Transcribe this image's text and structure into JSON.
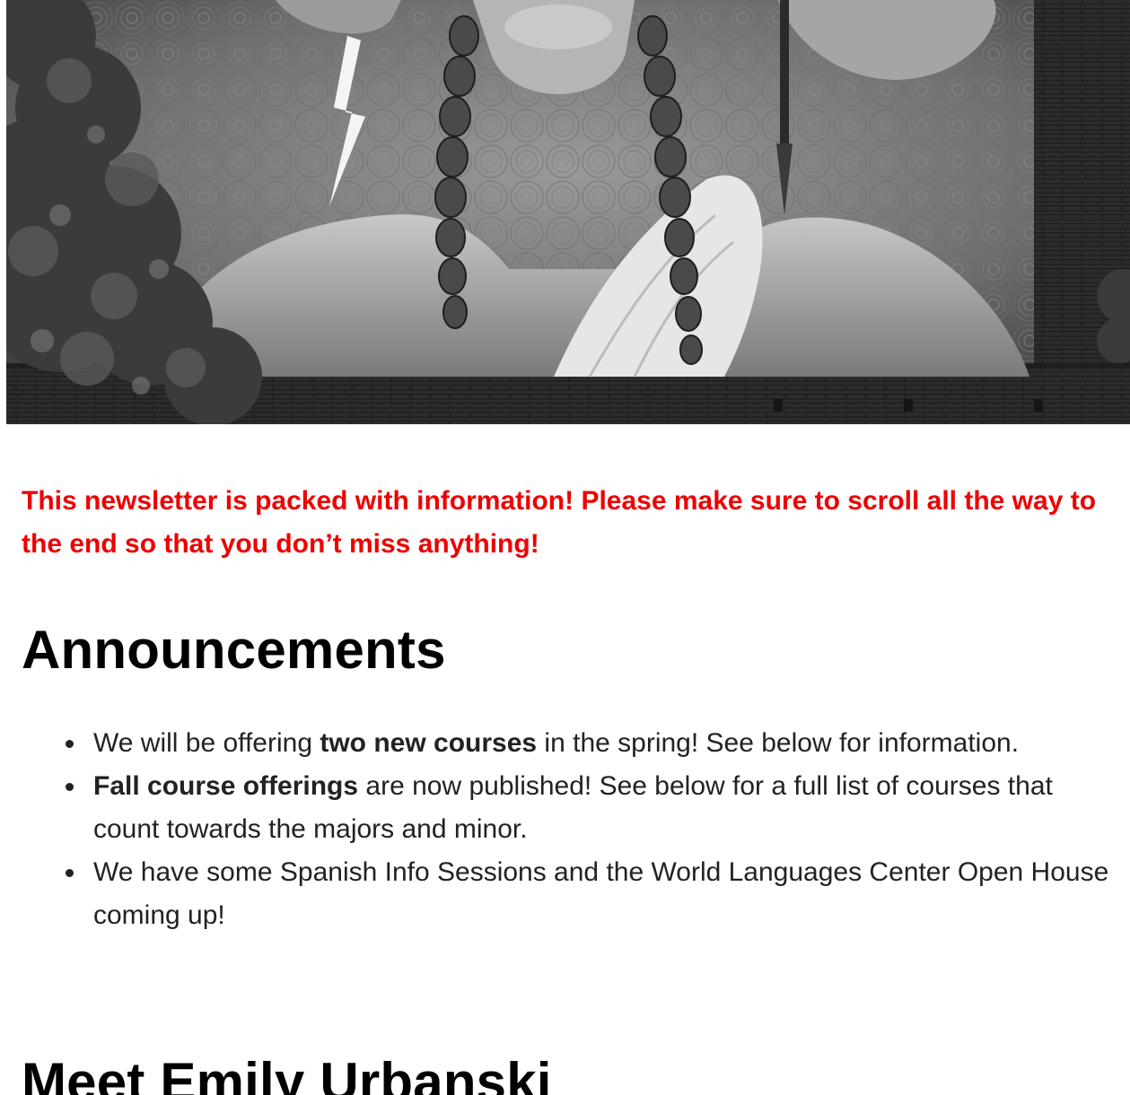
{
  "hero": {
    "image_name": "mural-of-woman-with-braids"
  },
  "notice": {
    "text": "This newsletter is packed with information! Please make sure to scroll all the way to the end so that you don’t miss anything!",
    "color": "#ee0000"
  },
  "announcements": {
    "title": "Announcements",
    "items": [
      {
        "before": "We will be offering ",
        "bold": "two new courses",
        "after": " in the spring! See below for information."
      },
      {
        "before": "",
        "bold": "Fall course offerings",
        "after": " are now published! See below for a full list of courses that count towards the majors and minor."
      },
      {
        "before": "We have some Spanish Info Sessions and the World Languages Center Open House coming up!",
        "bold": "",
        "after": ""
      }
    ]
  },
  "meet": {
    "title": "Meet Emily Urbanski"
  }
}
